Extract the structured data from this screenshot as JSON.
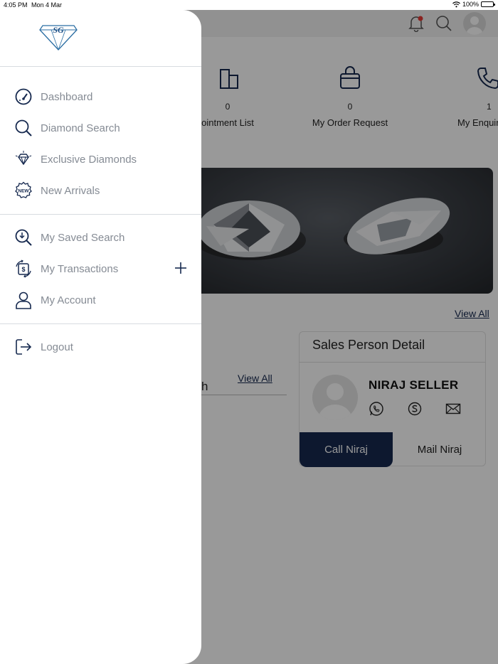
{
  "status_bar": {
    "time": "4:05 PM",
    "date": "Mon 4 Mar",
    "battery": "100%"
  },
  "background": {
    "stats": [
      {
        "count": "0",
        "label": "ointment List",
        "icon": "building-icon"
      },
      {
        "count": "0",
        "label": "My Order Request",
        "icon": "shopping-bag-icon"
      },
      {
        "count": "1",
        "label": "My Enquir",
        "icon": "phone-icon"
      }
    ],
    "view_all_top": "View All",
    "left_section_fragment": "h",
    "view_all_left": "View All",
    "sales_person": {
      "title": "Sales Person Detail",
      "name": "NIRAJ SELLER",
      "call_label": "Call Niraj",
      "mail_label": "Mail Niraj"
    }
  },
  "drawer": {
    "logo_text": "SG",
    "menu_group_1": [
      {
        "label": "Dashboard",
        "icon": "speedometer-icon"
      },
      {
        "label": "Diamond Search",
        "icon": "search-icon"
      },
      {
        "label": "Exclusive Diamonds",
        "icon": "diamond-icon"
      },
      {
        "label": "New Arrivals",
        "icon": "new-badge-icon",
        "badge": "NEW"
      }
    ],
    "menu_group_2": [
      {
        "label": "My Saved Search",
        "icon": "saved-search-icon"
      },
      {
        "label": "My Transactions",
        "icon": "transactions-icon",
        "currency": "$"
      },
      {
        "label": "My Account",
        "icon": "user-icon"
      }
    ],
    "menu_group_3": [
      {
        "label": "Logout",
        "icon": "logout-icon"
      }
    ]
  },
  "colors": {
    "brand_navy": "#16294f",
    "menu_text": "#858b94",
    "logo_blue": "#2b6ea3"
  }
}
